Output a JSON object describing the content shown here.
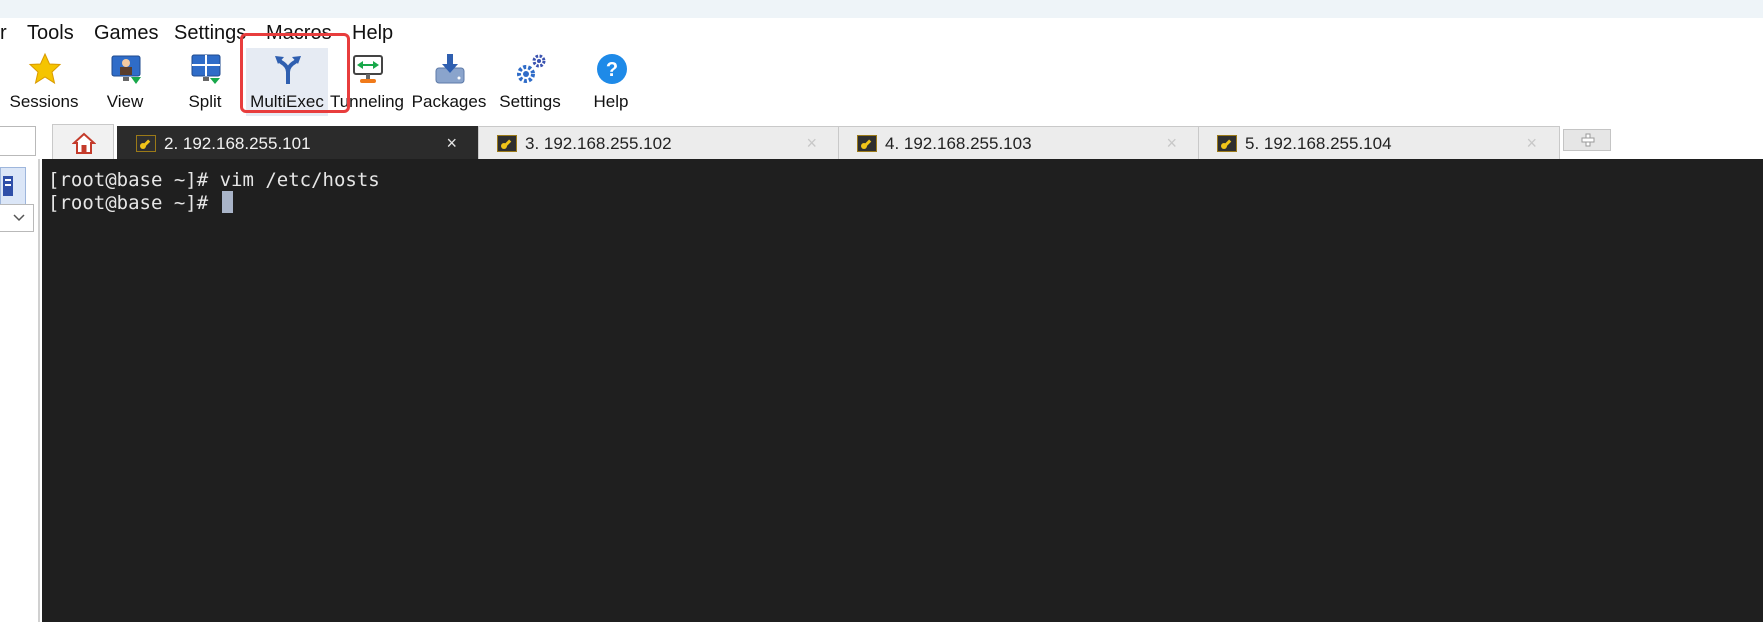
{
  "menu": {
    "items": [
      "r",
      "Tools",
      "Games",
      "Settings",
      "Macros",
      "Help"
    ]
  },
  "toolbar": {
    "buttons": [
      {
        "label": "Sessions",
        "icon": "star-icon"
      },
      {
        "label": "View",
        "icon": "monitor-user-icon"
      },
      {
        "label": "Split",
        "icon": "split-screen-icon"
      },
      {
        "label": "MultiExec",
        "icon": "fork-arrows-icon"
      },
      {
        "label": "Tunneling",
        "icon": "tunnel-arrows-icon"
      },
      {
        "label": "Packages",
        "icon": "download-package-icon"
      },
      {
        "label": "Settings",
        "icon": "gears-icon"
      },
      {
        "label": "Help",
        "icon": "question-icon"
      }
    ]
  },
  "tabs": [
    {
      "label": "2. 192.168.255.101",
      "active": true
    },
    {
      "label": "3. 192.168.255.102",
      "active": false
    },
    {
      "label": "4. 192.168.255.103",
      "active": false
    },
    {
      "label": "5. 192.168.255.104",
      "active": false
    }
  ],
  "tab_close_glyph": "×",
  "terminal": {
    "lines": [
      "[root@base ~]# vim /etc/hosts",
      "[root@base ~]# "
    ]
  },
  "colors": {
    "terminal_bg": "#1f1f1f",
    "highlight": "#e83d3d",
    "accent_blue": "#2f6cc8"
  }
}
